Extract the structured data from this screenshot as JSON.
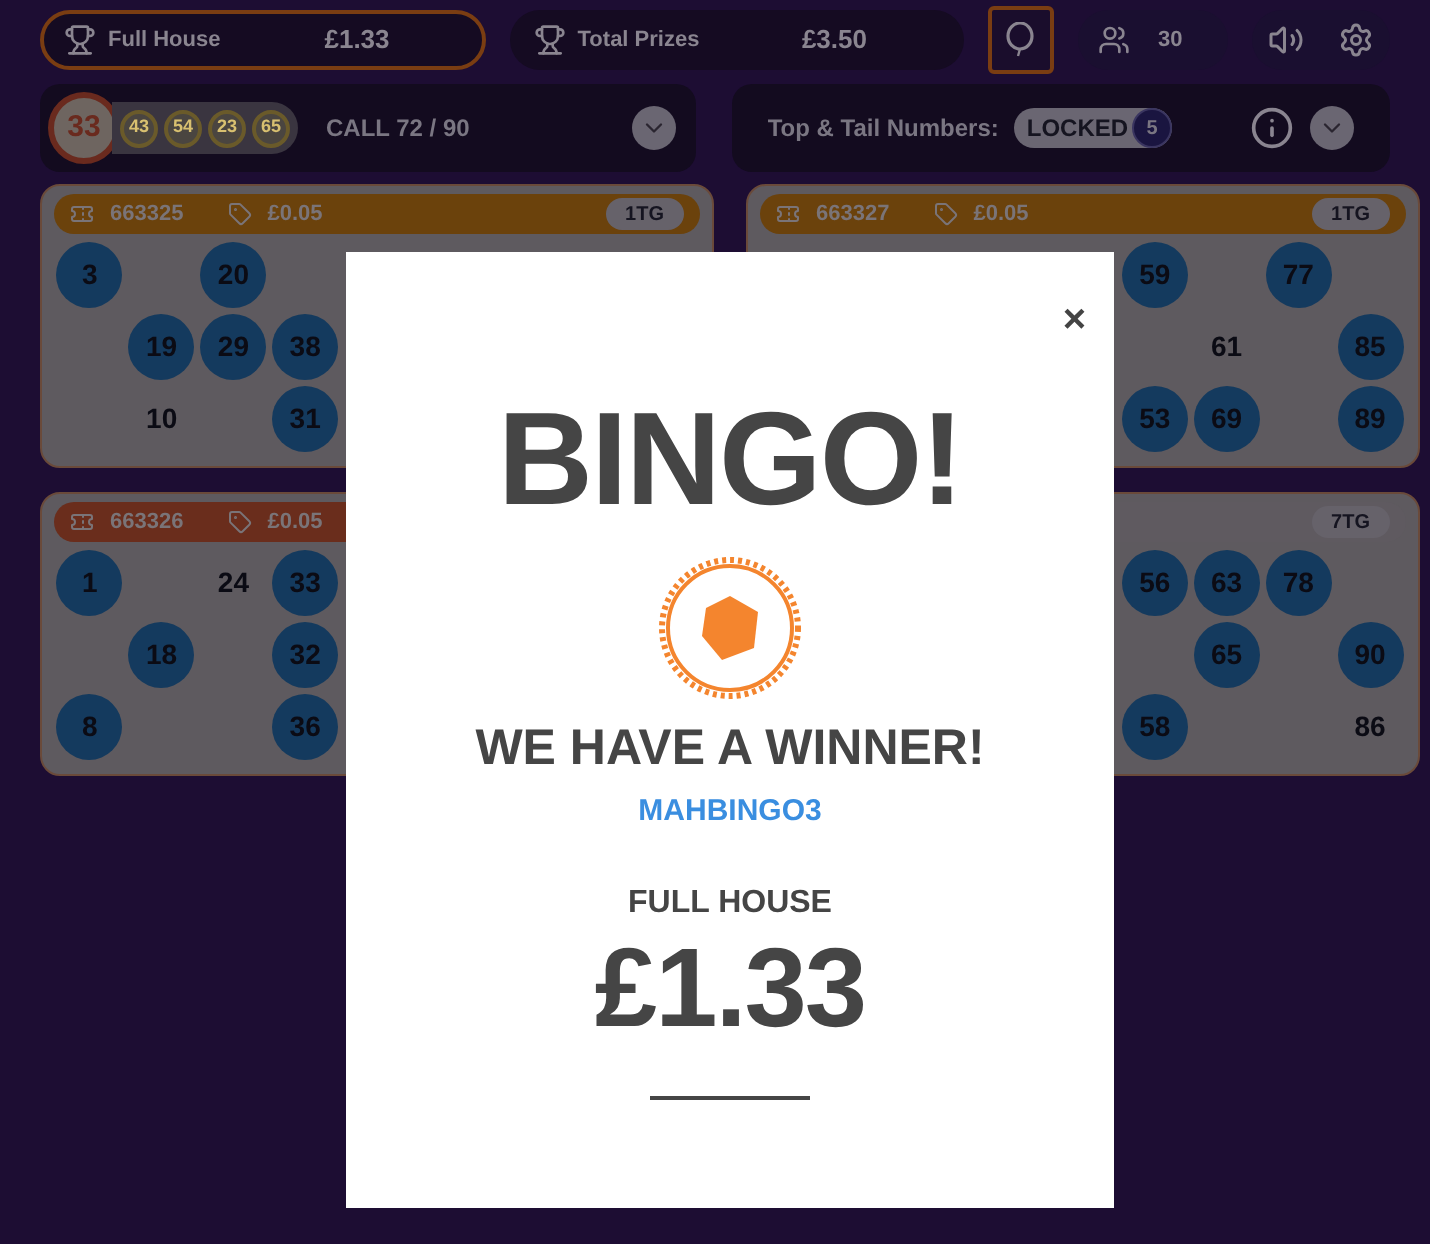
{
  "prizes": [
    {
      "label": "Full House",
      "amount": "£1.33",
      "selected": true
    },
    {
      "label": "Total Prizes",
      "amount": "£3.50",
      "selected": false
    }
  ],
  "balloon_button": {
    "selected": true
  },
  "players": {
    "count": "30"
  },
  "caller": {
    "current": "33",
    "previous": [
      "43",
      "54",
      "23",
      "65"
    ],
    "call": "CALL 72 / 90"
  },
  "top_tail": {
    "label": "Top & Tail Numbers:",
    "status": "LOCKED",
    "count": "5"
  },
  "tickets": [
    {
      "id": "663325",
      "price": "£0.05",
      "badge": "1TG",
      "color": "#6b420c",
      "rows": [
        [
          {
            "number": "3",
            "marked": true
          },
          "",
          {
            "number": "20",
            "marked": true
          },
          ""
        ],
        [
          "",
          {
            "number": "19",
            "marked": true
          },
          {
            "number": "29",
            "marked": true
          },
          {
            "number": "38",
            "marked": true
          }
        ],
        [
          "",
          {
            "number": "10",
            "marked": false
          },
          "",
          {
            "number": "31",
            "marked": true
          }
        ]
      ]
    },
    {
      "id": "663327",
      "price": "£0.05",
      "badge": "1TG",
      "color": "#6b420c",
      "rows": [
        [
          {
            "number": "59",
            "marked": true
          },
          "",
          {
            "number": "77",
            "marked": true
          },
          ""
        ],
        [
          "",
          {
            "number": "61",
            "marked": false
          },
          "",
          {
            "number": "85",
            "marked": true
          }
        ],
        [
          {
            "number": "53",
            "marked": true
          },
          {
            "number": "69",
            "marked": true
          },
          "",
          {
            "number": "89",
            "marked": true
          }
        ]
      ]
    },
    {
      "id": "663326",
      "price": "£0.05",
      "color": "#6a2d1c",
      "rows": [
        [
          {
            "number": "1",
            "marked": true
          },
          "",
          {
            "number": "24",
            "marked": false
          },
          {
            "number": "33",
            "marked": true
          }
        ],
        [
          "",
          {
            "number": "18",
            "marked": true
          },
          "",
          {
            "number": "32",
            "marked": true
          }
        ],
        [
          {
            "number": "8",
            "marked": true
          },
          "",
          "",
          {
            "number": "36",
            "marked": true
          }
        ]
      ]
    },
    {
      "badge": "7TG",
      "color": "#5f5a60",
      "rows": [
        [
          {
            "number": "56",
            "marked": true
          },
          {
            "number": "63",
            "marked": true
          },
          {
            "number": "78",
            "marked": true
          },
          ""
        ],
        [
          "",
          {
            "number": "65",
            "marked": true
          },
          "",
          {
            "number": "90",
            "marked": true
          }
        ],
        [
          {
            "number": "58",
            "marked": true
          },
          "",
          "",
          {
            "number": "86",
            "marked": false
          }
        ]
      ]
    }
  ],
  "modal": {
    "close": "×",
    "title": "BINGO!",
    "subtitle": "WE HAVE A WINNER!",
    "winner": "MAHBINGO3",
    "prize_label": "FULL HOUSE",
    "prize_amount": "£1.33"
  }
}
